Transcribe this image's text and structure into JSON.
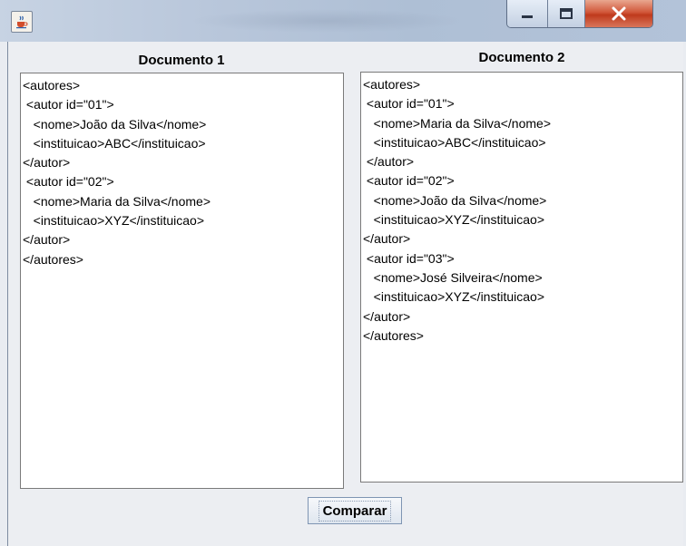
{
  "window": {
    "title": "",
    "buttons": {
      "minimize": "minimize",
      "maximize": "maximize",
      "close": "close"
    }
  },
  "left": {
    "title": "Documento 1",
    "lines": [
      "<autores>",
      " <autor id=\"01\">",
      "   <nome>João da Silva</nome>",
      "   <instituicao>ABC</instituicao>",
      "</autor>",
      " <autor id=\"02\">",
      "   <nome>Maria da Silva</nome>",
      "   <instituicao>XYZ</instituicao>",
      "</autor>",
      "</autores>"
    ]
  },
  "right": {
    "title": "Documento 2",
    "lines": [
      "<autores>",
      " <autor id=\"01\">",
      "   <nome>Maria da Silva</nome>",
      "   <instituicao>ABC</instituicao>",
      " </autor>",
      " <autor id=\"02\">",
      "   <nome>João da Silva</nome>",
      "   <instituicao>XYZ</instituicao>",
      "</autor>",
      " <autor id=\"03\">",
      "   <nome>José Silveira</nome>",
      "   <instituicao>XYZ</instituicao>",
      "</autor>",
      "</autores>"
    ]
  },
  "actions": {
    "compare_label": "Comparar"
  },
  "colors": {
    "close_red": "#c8442a",
    "titlebar": "#b9c7db"
  },
  "icons": {
    "app": "java-coffee-cup-icon"
  }
}
